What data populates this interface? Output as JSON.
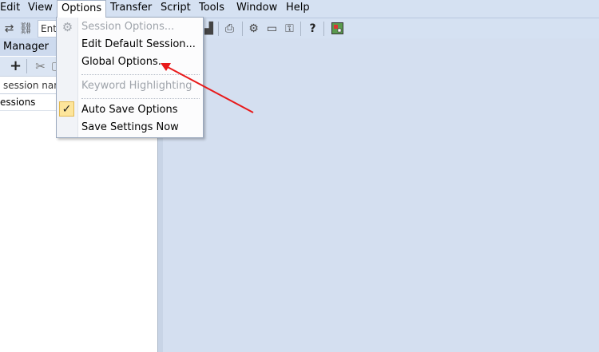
{
  "menubar": {
    "items": [
      "Edit",
      "View",
      "Options",
      "Transfer",
      "Script",
      "Tools",
      "Window",
      "Help"
    ],
    "active": "Options"
  },
  "toolbar": {
    "enter_text": "Ent",
    "icons": [
      "reconnect-icon",
      "link-icon",
      "find-icon",
      "print-icon",
      "gear-icon",
      "keyboard-icon",
      "key-icon",
      "help-icon",
      "map-icon"
    ]
  },
  "session_manager": {
    "title": "Manager",
    "filter_placeholder": "session nan",
    "tree_root": "essions",
    "tool_icons": [
      "plus-icon",
      "cut-icon",
      "copy-icon"
    ]
  },
  "options_menu": {
    "items": [
      {
        "label": "Session Options...",
        "enabled": false,
        "icon": "gear-icon"
      },
      {
        "label": "Edit Default Session...",
        "enabled": true
      },
      {
        "label": "Global Options...",
        "enabled": true
      },
      {
        "label": "Keyword Highlighting",
        "enabled": false
      },
      {
        "label": "Auto Save Options",
        "enabled": true,
        "checked": true
      },
      {
        "label": "Save Settings Now",
        "enabled": true
      }
    ]
  },
  "annotation": {
    "color": "#e8191a"
  }
}
